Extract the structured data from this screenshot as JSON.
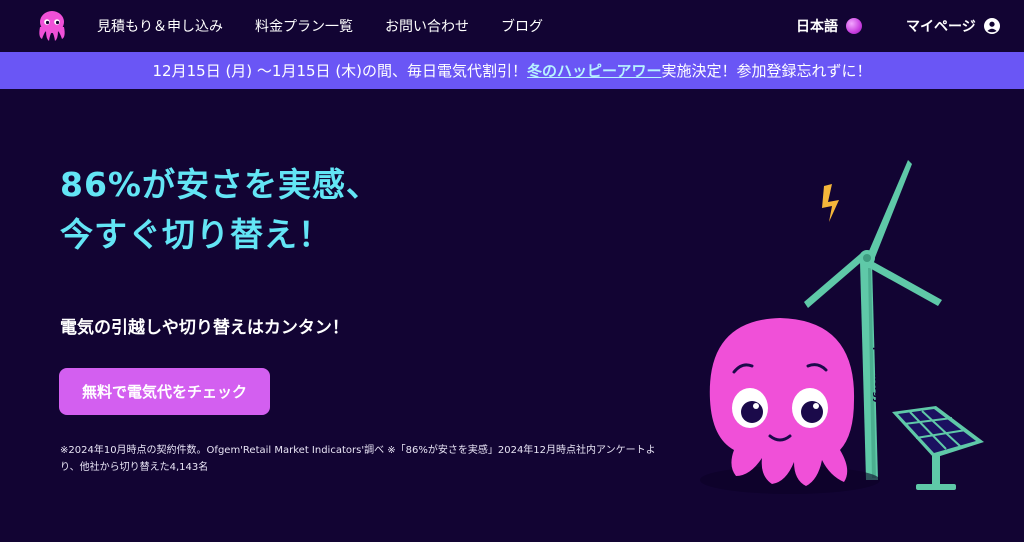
{
  "header": {
    "nav": [
      {
        "label": "見積もり＆申し込み"
      },
      {
        "label": "料金プラン一覧"
      },
      {
        "label": "お問い合わせ"
      },
      {
        "label": "ブログ"
      }
    ],
    "language": "日本語",
    "mypage": "マイページ"
  },
  "banner": {
    "prefix": "12月15日 (月) 〜1月15日 (木)の間、毎日電気代割引！",
    "link": "冬のハッピーアワー",
    "suffix": "実施決定！参加登録忘れずに！"
  },
  "hero": {
    "headline_line1": "86%が安さを実感、",
    "headline_line2": "今すぐ切り替え！",
    "subhead": "電気の引越しや切り替えはカンタン！",
    "cta": "無料で電気代をチェック",
    "note": "※2024年10月時点の契約件数。Ofgem'Retail Market Indicators'調べ ※「86%が安さを実感」2024年12月時点社内アンケートより、他社から切り替えた4,143名"
  },
  "illustration": {
    "turbine_brand": "octopus energy"
  },
  "colors": {
    "background": "#120433",
    "banner": "#6a56f5",
    "headline": "#63e5f5",
    "cta": "#d35ff0",
    "octopus": "#f050d8",
    "turbine": "#5fc9a8"
  }
}
